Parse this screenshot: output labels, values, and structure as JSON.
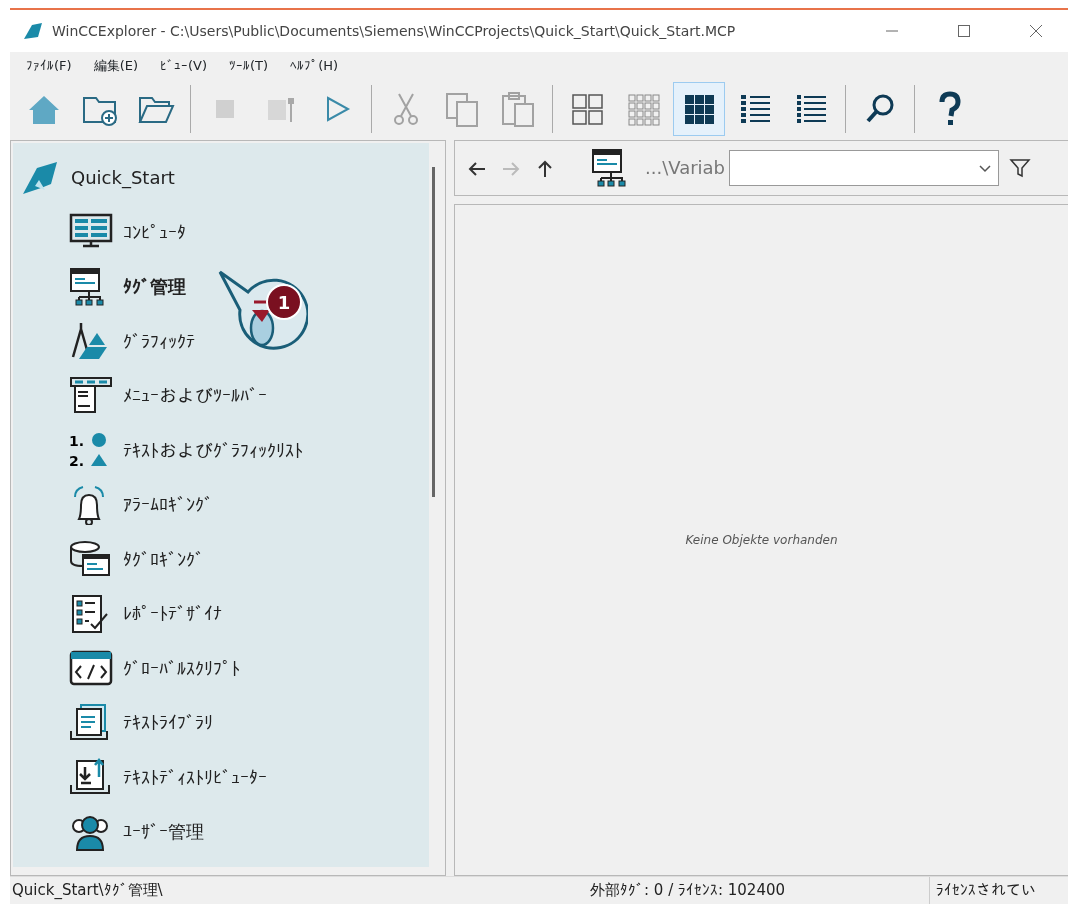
{
  "window": {
    "title": "WinCCExplorer - C:\\Users\\Public\\Documents\\Siemens\\WinCCProjects\\Quick_Start\\Quick_Start.MCP"
  },
  "menu": [
    "ﾌｧｲﾙ(F)",
    "編集(E)",
    "ﾋﾞｭｰ(V)",
    "ﾂｰﾙ(T)",
    "ﾍﾙﾌﾟ(H)"
  ],
  "toolbar": [
    {
      "kind": "home",
      "disabled": false,
      "selected": false
    },
    {
      "kind": "newfolder",
      "disabled": false,
      "selected": false
    },
    {
      "kind": "open",
      "disabled": false,
      "selected": false
    },
    {
      "kind": "sep"
    },
    {
      "kind": "stop",
      "disabled": true,
      "selected": false
    },
    {
      "kind": "props",
      "disabled": true,
      "selected": false
    },
    {
      "kind": "run",
      "disabled": false,
      "selected": false
    },
    {
      "kind": "sep"
    },
    {
      "kind": "cut",
      "disabled": true,
      "selected": false
    },
    {
      "kind": "copy",
      "disabled": true,
      "selected": false
    },
    {
      "kind": "paste",
      "disabled": true,
      "selected": false
    },
    {
      "kind": "sep"
    },
    {
      "kind": "largeicons",
      "disabled": false,
      "selected": false
    },
    {
      "kind": "smallicons",
      "disabled": false,
      "selected": false
    },
    {
      "kind": "tiles",
      "disabled": false,
      "selected": true
    },
    {
      "kind": "details",
      "disabled": false,
      "selected": false
    },
    {
      "kind": "list",
      "disabled": false,
      "selected": false
    },
    {
      "kind": "sep"
    },
    {
      "kind": "search",
      "disabled": false,
      "selected": false
    },
    {
      "kind": "sep"
    },
    {
      "kind": "help",
      "disabled": false,
      "selected": false
    }
  ],
  "tree": {
    "root": "Quick_Start",
    "items": [
      {
        "label": "ｺﾝﾋﾟｭｰﾀ",
        "kind": "computer",
        "selected": false
      },
      {
        "label": "ﾀｸﾞ管理",
        "kind": "tags",
        "selected": true
      },
      {
        "label": "ｸﾞﾗﾌｨｯｸﾃ",
        "kind": "graphics",
        "selected": false
      },
      {
        "label": "ﾒﾆｭｰおよびﾂｰﾙﾊﾞｰ",
        "kind": "menus",
        "selected": false
      },
      {
        "label": "ﾃｷｽﾄおよびｸﾞﾗﾌｨｯｸﾘｽﾄ",
        "kind": "textlists",
        "selected": false,
        "icon_text": [
          "1.",
          "2."
        ]
      },
      {
        "label": "ｱﾗｰﾑﾛｷﾞﾝｸﾞ",
        "kind": "alarm",
        "selected": false
      },
      {
        "label": "ﾀｸﾞﾛｷﾞﾝｸﾞ",
        "kind": "taglog",
        "selected": false
      },
      {
        "label": "ﾚﾎﾟｰﾄﾃﾞｻﾞｲﾅ",
        "kind": "report",
        "selected": false
      },
      {
        "label": "ｸﾞﾛｰﾊﾞﾙｽｸﾘﾌﾟﾄ",
        "kind": "script",
        "selected": false
      },
      {
        "label": "ﾃｷｽﾄﾗｲﾌﾞﾗﾘ",
        "kind": "textlib",
        "selected": false
      },
      {
        "label": "ﾃｷｽﾄﾃﾞｨｽﾄﾘﾋﾞｭｰﾀｰ",
        "kind": "textdist",
        "selected": false
      },
      {
        "label": "ﾕｰｻﾞｰ管理",
        "kind": "users",
        "selected": false
      }
    ]
  },
  "callout": {
    "badge": "1"
  },
  "nav": {
    "back_disabled": false,
    "forward_disabled": true,
    "up_disabled": false,
    "path": "...\\Variab"
  },
  "content": {
    "empty_text": "Keine Objekte vorhanden"
  },
  "status_bar": {
    "path": "Quick_Start\\ﾀｸﾞ管理\\",
    "tags": "外部ﾀｸﾞ: 0 / ﾗｲｾﾝｽ: 102400",
    "license": "ﾗｲｾﾝｽされてい"
  }
}
